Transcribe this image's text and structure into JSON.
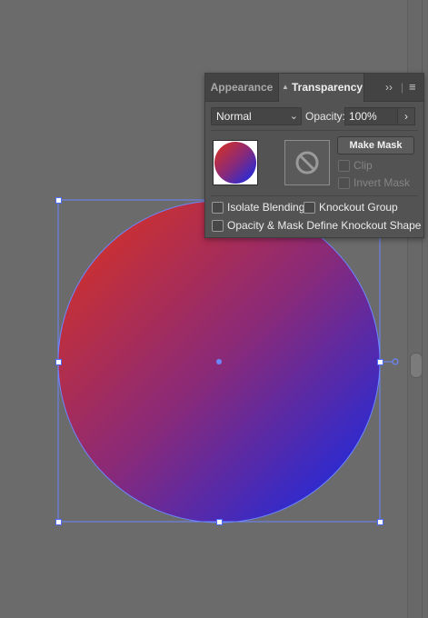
{
  "colors": {
    "canvas": "#6b6b6b",
    "gradient_start": "#d62c1b",
    "gradient_end": "#1428e8",
    "selection": "#6b86ff"
  },
  "panel": {
    "tabs": [
      {
        "label": "Appearance",
        "active": false
      },
      {
        "label": "Transparency",
        "active": true
      }
    ],
    "menu_icons": [
      "expand-chevrons-icon",
      "panel-menu-icon"
    ],
    "blend_mode": {
      "selected": "Normal"
    },
    "opacity": {
      "label": "Opacity:",
      "value": "100%"
    },
    "make_mask_label": "Make Mask",
    "clip": {
      "label": "Clip",
      "checked": false,
      "enabled": false
    },
    "invert_mask": {
      "label": "Invert Mask",
      "checked": false,
      "enabled": false
    },
    "isolate_blending": {
      "label": "Isolate Blending",
      "checked": false
    },
    "knockout_group": {
      "label": "Knockout Group",
      "checked": false
    },
    "opacity_mask_knockout": {
      "label": "Opacity & Mask Define Knockout Shape",
      "checked": false
    }
  }
}
